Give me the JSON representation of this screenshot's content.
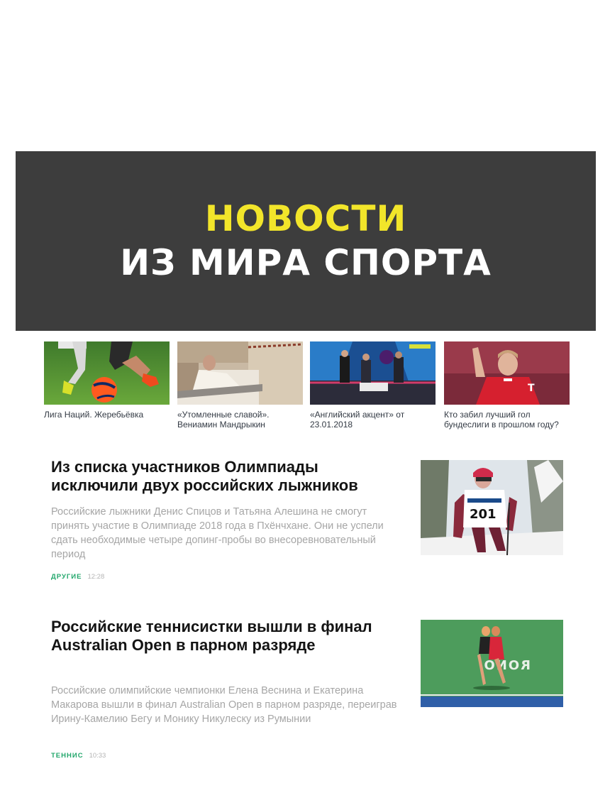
{
  "banner": {
    "line1": "НОВОСТИ",
    "line2": "ИЗ МИРА СПОРТА",
    "accent_color": "#f2e52a",
    "background_color": "#3d3d3d"
  },
  "thumbnails": [
    {
      "caption": "Лига Наций. Жеребьёвка",
      "icon": "football-photo"
    },
    {
      "caption": "«Утомленные славой». Вениамин Мандрыкин",
      "icon": "hospital-photo"
    },
    {
      "caption": "«Английский акцент» от 23.01.2018",
      "icon": "tv-studio-photo"
    },
    {
      "caption": "Кто забил лучший гол бундеслиги в прошлом году?",
      "icon": "football-player-photo"
    }
  ],
  "articles": [
    {
      "title": "Из списка участников Олимпиады исключили двух российских лыжников",
      "lead": "Российские лыжники Денис Спицов и Татьяна Алешина не смогут принять участие в Олимпиаде 2018 года в Пхёнчхане. Они не успели сдать необходимые четыре допинг-пробы во внесоревновательный период",
      "rubric": "ДРУГИЕ",
      "time": "12:28",
      "bib_number": "201"
    },
    {
      "title": "Российские теннисистки вышли в финал Australian Open в парном разряде",
      "lead": "Российские олимпийские чемпионки Елена Веснина и Екатерина Макарова вышли в финал Australian Open в парном разряде, переиграв Ирину-Камелию Бегу и Монику Никулеску из Румынии",
      "rubric": "ТЕННИС",
      "time": "10:33",
      "court_text": "RONO"
    }
  ],
  "colors": {
    "rubric": "#22a76b",
    "meta_time": "#b4b4b4"
  }
}
